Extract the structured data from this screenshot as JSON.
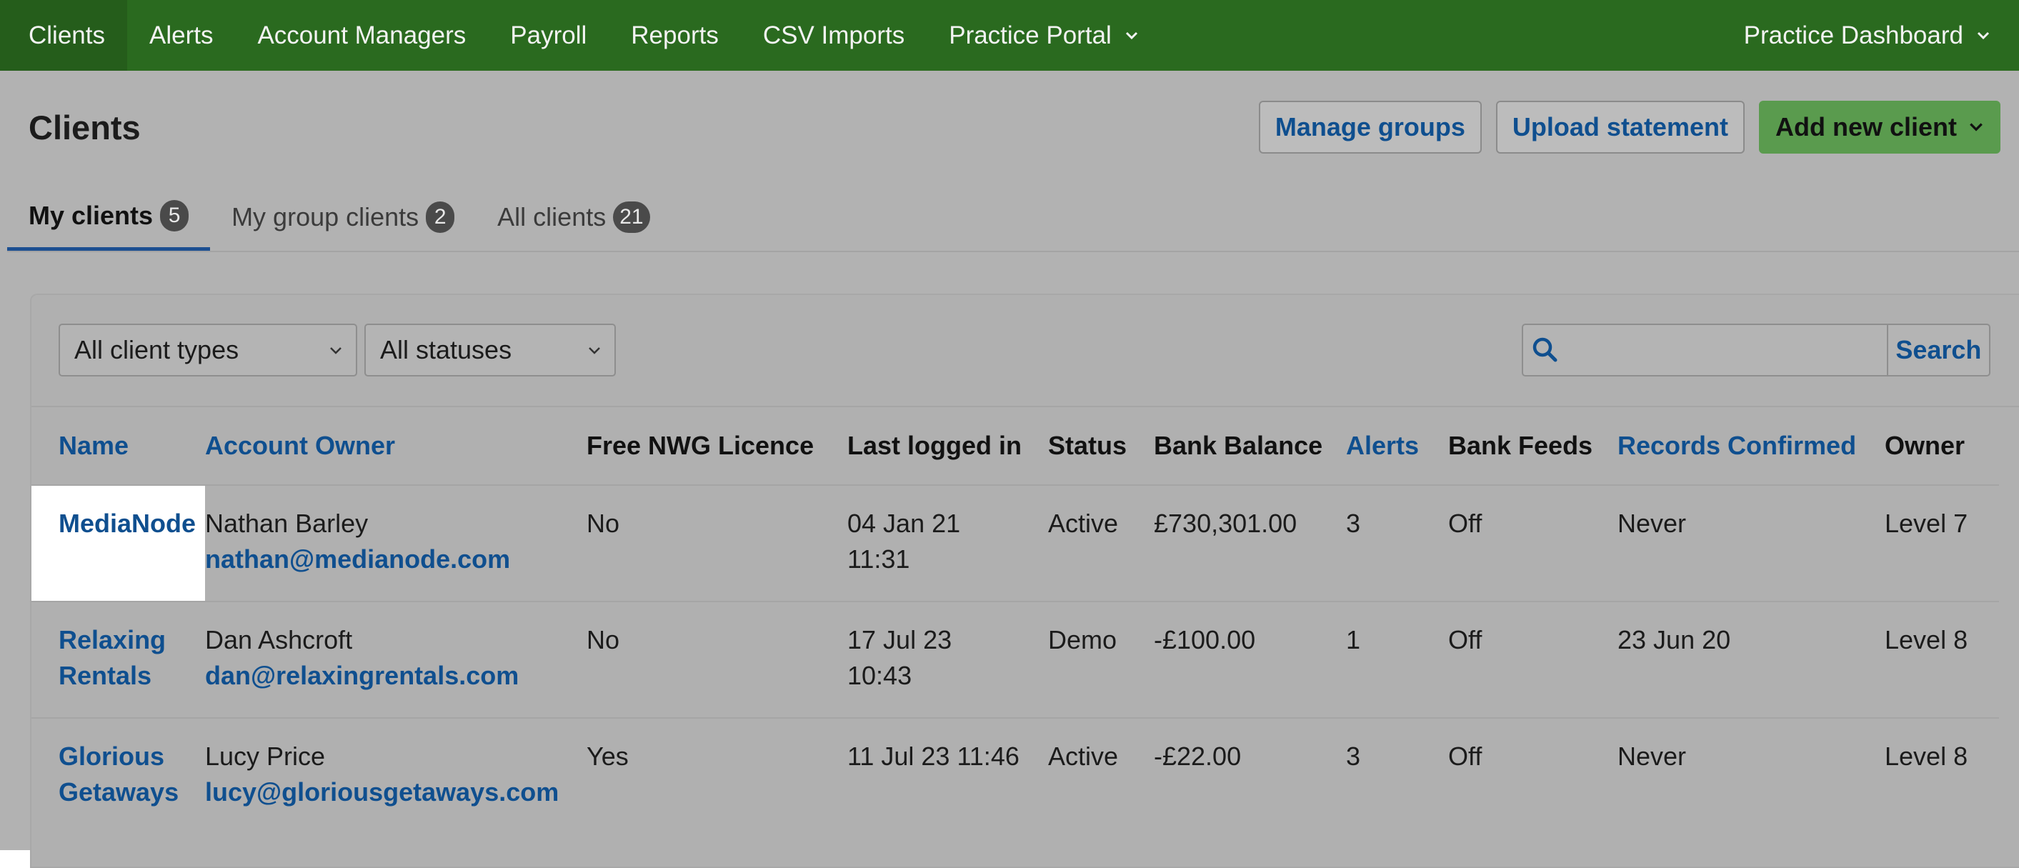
{
  "nav": {
    "items": [
      "Clients",
      "Alerts",
      "Account Managers",
      "Payroll",
      "Reports",
      "CSV Imports",
      "Practice Portal"
    ],
    "right": "Practice Dashboard"
  },
  "page": {
    "title": "Clients"
  },
  "actions": {
    "manage_groups": "Manage groups",
    "upload_statement": "Upload statement",
    "add_new_client": "Add new client"
  },
  "tabs": [
    {
      "label": "My clients",
      "count": "5"
    },
    {
      "label": "My group clients",
      "count": "2"
    },
    {
      "label": "All clients",
      "count": "21"
    }
  ],
  "filters": {
    "client_types": "All client types",
    "statuses": "All statuses"
  },
  "search": {
    "placeholder": "",
    "button": "Search"
  },
  "table": {
    "headers": [
      "Name",
      "Account Owner",
      "Free NWG Licence",
      "Last logged in",
      "Status",
      "Bank Balance",
      "Alerts",
      "Bank Feeds",
      "Records Confirmed",
      "Owner"
    ],
    "rows": [
      {
        "name": "MediaNode",
        "owner_name": "Nathan Barley",
        "owner_email": "nathan@medianode.com",
        "licence": "No",
        "last_login": "04 Jan 21 11:31",
        "status": "Active",
        "balance": "£730,301.00",
        "alerts": "3",
        "feeds": "Off",
        "confirmed": "Never",
        "owner": "Level 7"
      },
      {
        "name": "Relaxing Rentals",
        "owner_name": "Dan Ashcroft",
        "owner_email": "dan@relaxingrentals.com",
        "licence": "No",
        "last_login": "17 Jul 23 10:43",
        "status": "Demo",
        "balance": "-£100.00",
        "alerts": "1",
        "feeds": "Off",
        "confirmed": "23 Jun 20",
        "owner": "Level 8"
      },
      {
        "name": "Glorious Getaways",
        "owner_name": "Lucy Price",
        "owner_email": "lucy@gloriousgetaways.com",
        "licence": "Yes",
        "last_login": "11 Jul 23 11:46",
        "status": "Active",
        "balance": "-£22.00",
        "alerts": "3",
        "feeds": "Off",
        "confirmed": "Never",
        "owner": "Level 8"
      }
    ]
  },
  "colors": {
    "nav_bg": "#2a6a1f",
    "link": "#0f4f8f",
    "primary_button": "#5a9b4e"
  }
}
